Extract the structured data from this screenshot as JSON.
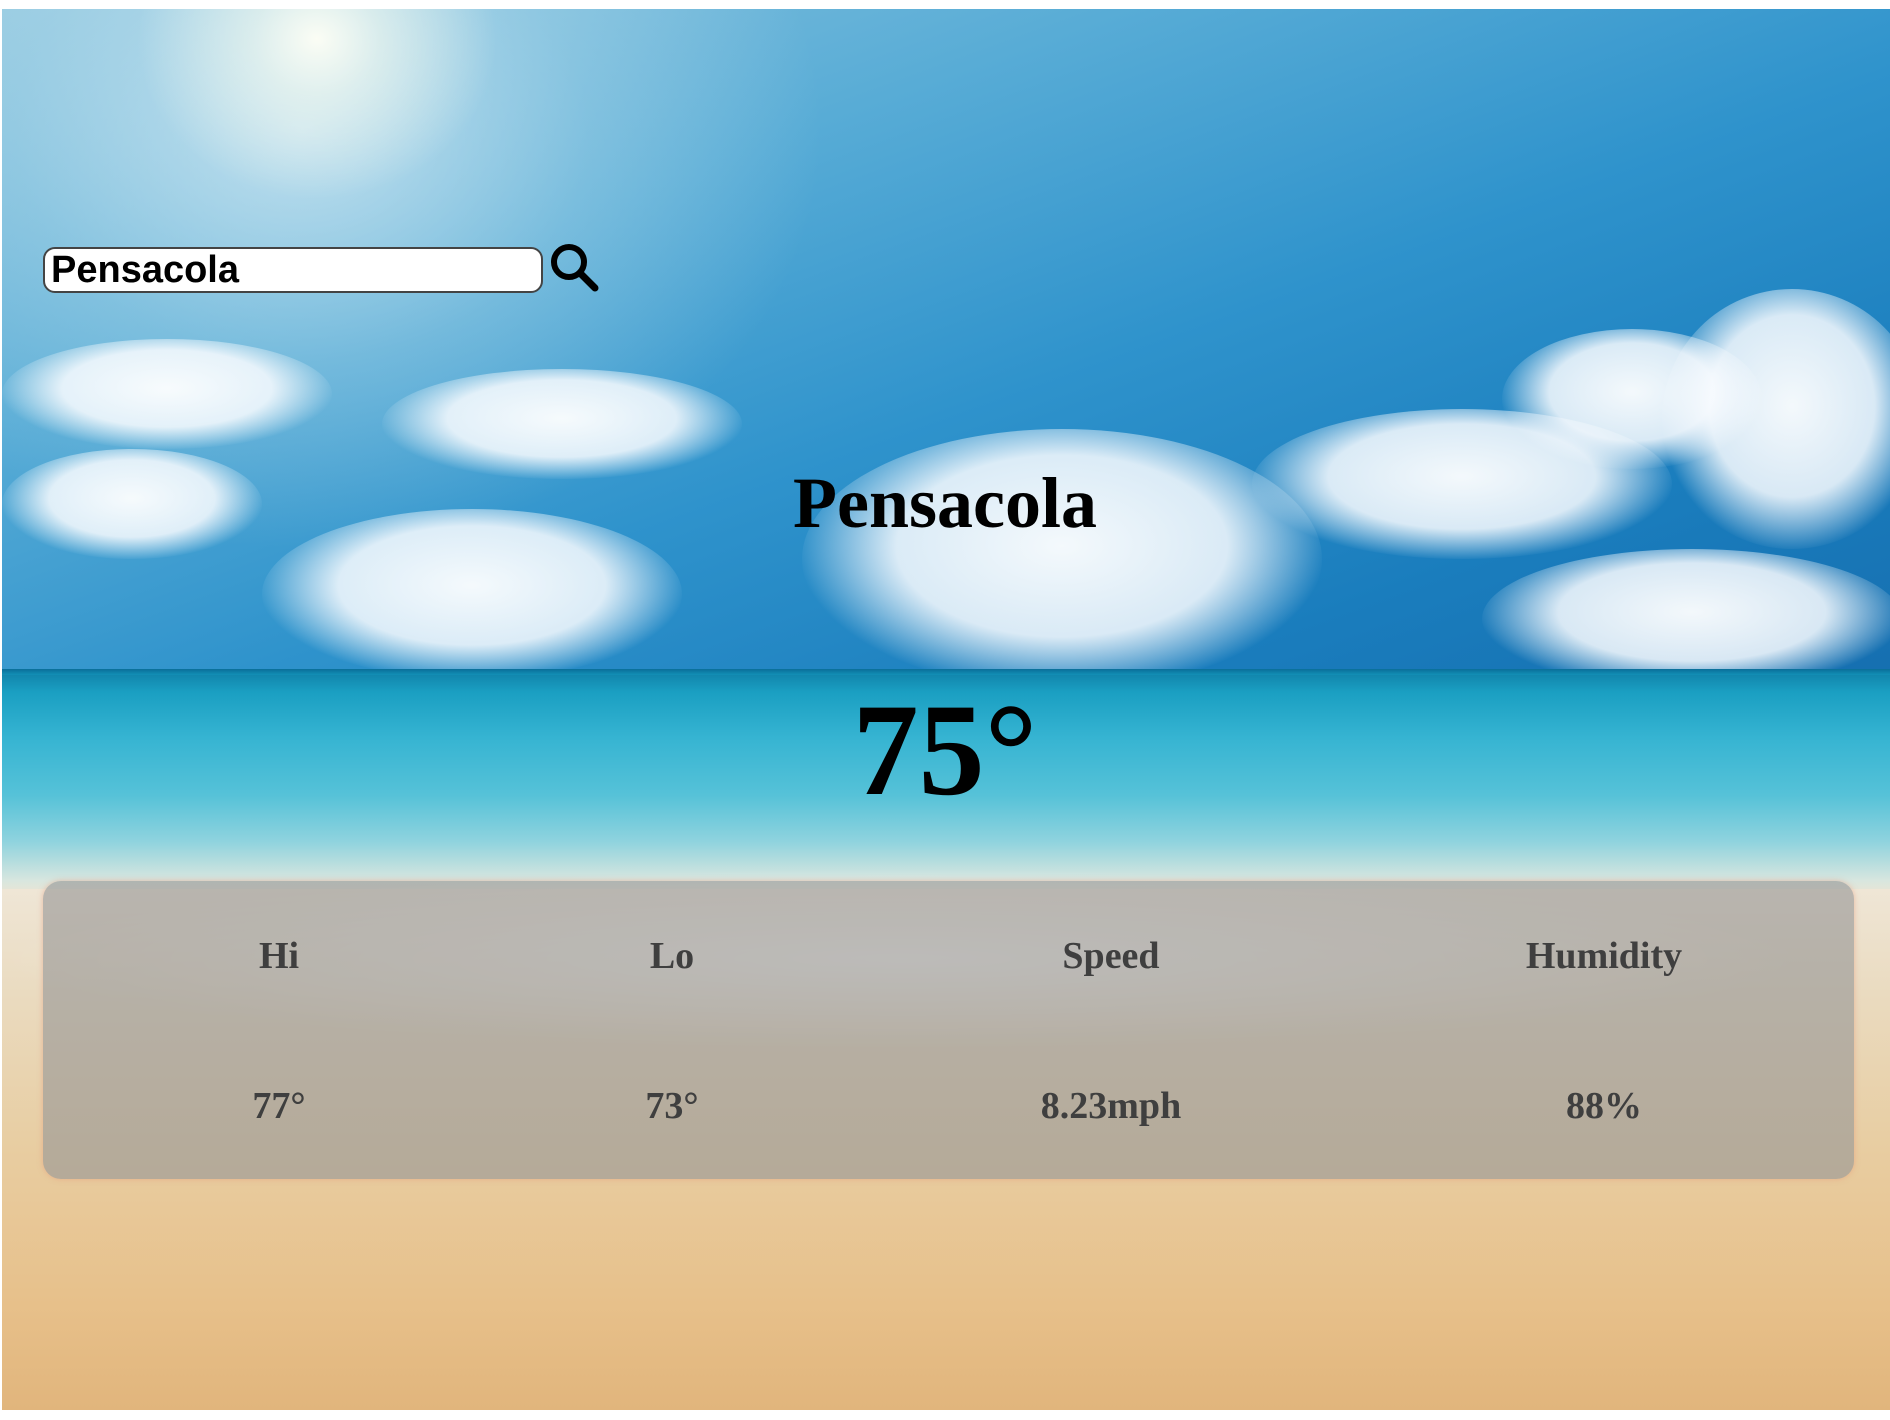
{
  "search": {
    "value": "Pensacola",
    "icon": "search-icon"
  },
  "weather": {
    "city": "Pensacola",
    "temperature": "75°"
  },
  "stats": [
    {
      "label": "Hi",
      "value": "77°"
    },
    {
      "label": "Lo",
      "value": "73°"
    },
    {
      "label": "Speed",
      "value": "8.23mph"
    },
    {
      "label": "Humidity",
      "value": "88%"
    }
  ]
}
